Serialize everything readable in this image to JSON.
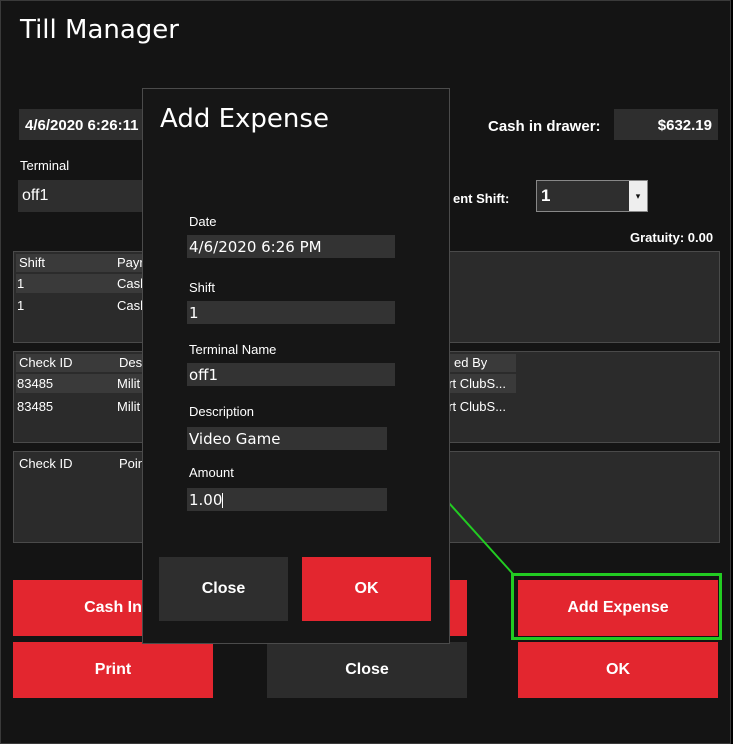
{
  "window": {
    "title": "Till Manager"
  },
  "top": {
    "date_value": "4/6/2020 6:26:11",
    "cash_label": "Cash in drawer:",
    "cash_value": "$632.19"
  },
  "terminal": {
    "label": "Terminal",
    "value": "off1"
  },
  "shift": {
    "label": "ent Shift:",
    "value": "1",
    "dropdown_glyph": "▾"
  },
  "gratuity": "Gratuity: 0.00",
  "grid1": {
    "headers": [
      "Shift",
      "Payr"
    ],
    "rows": [
      [
        "1",
        "Cash"
      ],
      [
        "1",
        "Cash"
      ]
    ]
  },
  "grid2": {
    "headers": [
      "Check ID",
      "Desc",
      "ed By"
    ],
    "rows": [
      [
        "83485",
        "Milit",
        "ort ClubS..."
      ],
      [
        "83485",
        "Milit",
        "ort ClubS..."
      ]
    ]
  },
  "grid3": {
    "headers": [
      "Check ID",
      "Poin"
    ]
  },
  "buttons": {
    "cash_in": "Cash In",
    "add_expense": "Add Expense",
    "print": "Print",
    "close": "Close",
    "ok": "OK"
  },
  "dialog": {
    "title": "Add Expense",
    "date_label": "Date",
    "date_value": "4/6/2020 6:26 PM",
    "shift_label": "Shift",
    "shift_value": "1",
    "terminal_label": "Terminal Name",
    "terminal_value": "off1",
    "description_label": "Description",
    "description_value": "Video Game",
    "amount_label": "Amount",
    "amount_value": "1.00",
    "close_label": "Close",
    "ok_label": "OK"
  },
  "colors": {
    "accent_red": "#e3262f",
    "callout_green": "#22cc22"
  }
}
